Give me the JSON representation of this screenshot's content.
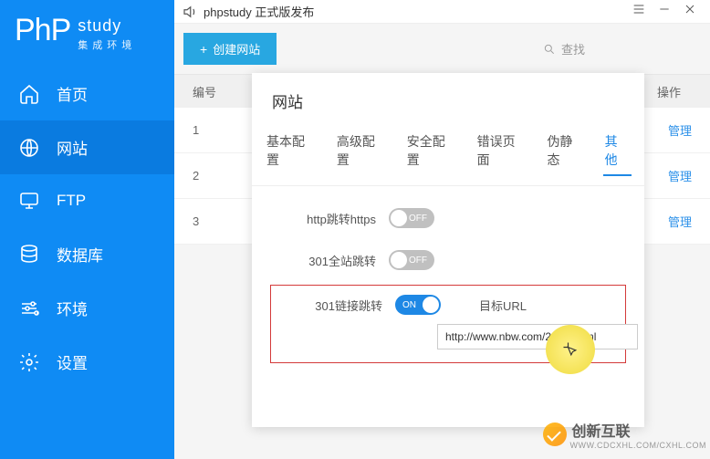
{
  "brand": {
    "logo_main": "PhP",
    "logo_side": "study",
    "logo_sub": "集成环境"
  },
  "titlebar": {
    "title": "phpstudy 正式版发布"
  },
  "sidebar": {
    "items": [
      {
        "label": "首页"
      },
      {
        "label": "网站"
      },
      {
        "label": "FTP"
      },
      {
        "label": "数据库"
      },
      {
        "label": "环境"
      },
      {
        "label": "设置"
      }
    ]
  },
  "toolbar": {
    "create": "创建网站",
    "search_placeholder": "查找"
  },
  "table": {
    "head_index": "编号",
    "head_ops": "操作",
    "rows": [
      {
        "index": "1",
        "ops": "管理"
      },
      {
        "index": "2",
        "ops": "管理"
      },
      {
        "index": "3",
        "ops": "管理"
      }
    ]
  },
  "modal": {
    "title": "网站",
    "tabs": [
      "基本配置",
      "高级配置",
      "安全配置",
      "错误页面",
      "伪静态",
      "其他"
    ],
    "active_tab": 5,
    "opts": {
      "http_to_https": {
        "label": "http跳转https",
        "state": "OFF"
      },
      "site_301": {
        "label": "301全站跳转",
        "state": "OFF"
      },
      "link_301": {
        "label": "301链接跳转",
        "state": "ON",
        "target_label": "目标URL",
        "target_value": "http://www.nbw.com/2/234.html"
      }
    }
  },
  "watermark": {
    "text": "创新互联",
    "sub": "WWW.CDCXHL.COM/CXHL.COM"
  }
}
